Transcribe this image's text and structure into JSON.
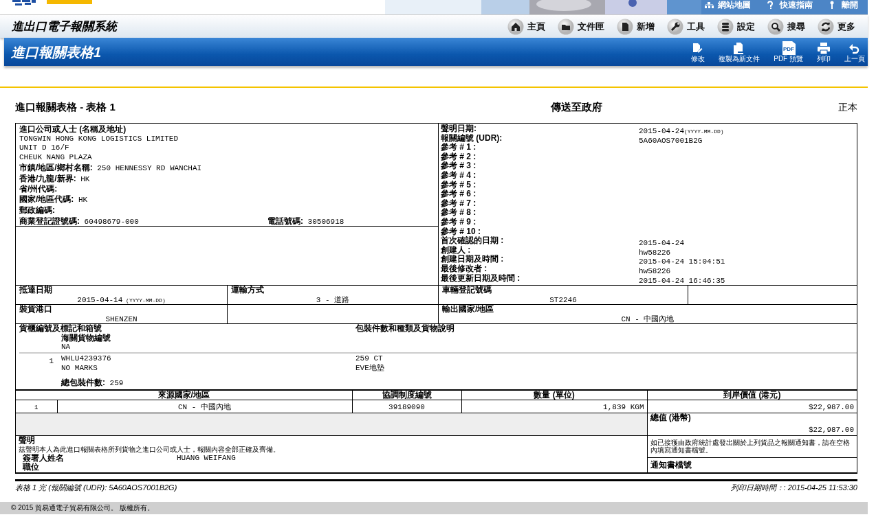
{
  "top_links": [
    {
      "label": "網站地圖",
      "kind": "sitemap"
    },
    {
      "label": "快速指南",
      "kind": "help"
    },
    {
      "label": "離開",
      "kind": "exit"
    }
  ],
  "system_title": "進出口電子報關系統",
  "nav": [
    {
      "label": "主頁",
      "kind": "home"
    },
    {
      "label": "文件匣",
      "kind": "folder"
    },
    {
      "label": "新增",
      "kind": "new"
    },
    {
      "label": "工具",
      "kind": "tools"
    },
    {
      "label": "設定",
      "kind": "settings"
    },
    {
      "label": "搜尋",
      "kind": "search"
    },
    {
      "label": "更多",
      "kind": "more"
    }
  ],
  "page_title": "進口報關表格1",
  "actions": [
    {
      "label": "修改",
      "kind": "edit"
    },
    {
      "label": "複製為新文件",
      "kind": "copy"
    },
    {
      "label": "PDF 預覽",
      "kind": "pdf",
      "icon_text": "PDF"
    },
    {
      "label": "列印",
      "kind": "print"
    },
    {
      "label": "上一頁",
      "kind": "back"
    }
  ],
  "form": {
    "title": "進口報關表格 - 表格 1",
    "destination": "傳送至政府",
    "copy_type": "正本",
    "importer": {
      "heading": "進口公司或人士 (名稱及地址)",
      "lines": [
        "TONGWIN HONG KONG LOGISTICS LIMITED",
        "UNIT D 16/F",
        "CHEUK NANG PLAZA"
      ],
      "fields": [
        {
          "label": "市鎮/地區/鄉村名稱:",
          "value": "250 HENNESSY RD WANCHAI"
        },
        {
          "label": "香港/九龍/新界:",
          "value": "HK"
        },
        {
          "label": "省/州代碼:"
        },
        {
          "label": "國家/地區代碼:",
          "value": "HK"
        },
        {
          "label": "郵政編碼:"
        }
      ],
      "br_label": "商業登記證號碼:",
      "br_value": "60498679-000",
      "phone_label": "電話號碼:",
      "phone_value": "30506918"
    },
    "declaration_info": [
      {
        "label": "聲明日期:",
        "value": "2015-04-24",
        "hint": "(YYYY-MM-DD)"
      },
      {
        "label": "報關編號 (UDR):",
        "value": "5A60AOS7001B2G"
      },
      {
        "label": "參考 # 1 :"
      },
      {
        "label": "參考 # 2 :"
      },
      {
        "label": "參考 # 3 :"
      },
      {
        "label": "參考 # 4 :"
      },
      {
        "label": "參考 # 5 :"
      },
      {
        "label": "參考 # 6 :"
      },
      {
        "label": "參考 # 7 :"
      },
      {
        "label": "參考 # 8 :"
      },
      {
        "label": "參考 # 9 :"
      },
      {
        "label": "參考 # 10 :"
      },
      {
        "label": "首次確認的日期 :",
        "value": "2015-04-24"
      },
      {
        "label": "創建人 :",
        "value": "hw58226"
      },
      {
        "label": "創建日期及時間 :",
        "value": "2015-04-24 15:04:51"
      },
      {
        "label": "最後修改者 :",
        "value": "hw58226"
      },
      {
        "label": "最後更新日期及時間 :",
        "value": "2015-04-24 16:46:35"
      }
    ],
    "arrival": {
      "label": "抵達日期",
      "value": "2015-04-14",
      "hint": "(YYYY-MM-DD)"
    },
    "transport": {
      "label": "運輸方式",
      "value": "3 - 道路"
    },
    "vehicle": {
      "label": "車輛登記號碼",
      "value": "ST2246"
    },
    "loading_port": {
      "label": "裝貨港口",
      "value": "SHENZEN"
    },
    "export_country": {
      "label": "輸出國家/地區",
      "value": "CN - 中國內地"
    },
    "goods": {
      "marks_heading": "貨櫃編號及標記和箱號",
      "desc_heading": "包裝件數和種類及貨物說明",
      "cargo_no_label": "海關貨物編號",
      "cargo_no": "NA",
      "items": [
        {
          "no": "1",
          "marks": [
            "WHLU4239376",
            "NO MARKS"
          ],
          "description": [
            "259 CT",
            "EVE地墊"
          ]
        }
      ],
      "total_label": "總包裝件數:",
      "total": "259"
    },
    "lines_table": {
      "columns": [
        "來源國家/地區",
        "協調制度編號",
        "數量 (單位)",
        "到岸價值 (港元)"
      ],
      "rows": [
        {
          "no": "1",
          "cells": [
            "CN - 中國內地",
            "39189090",
            "1,839 KGM",
            "$22,987.00"
          ]
        }
      ]
    },
    "total_value": {
      "label": "總值 (港幣)",
      "value": "$22,987.00"
    },
    "statement": {
      "heading": "聲明",
      "text": "茲聲明本人為此進口報關表格所列貨物之進口公司或人士，報關內容全部正確及齊備。",
      "signer_label": "簽署人姓名",
      "signer": "HUANG WEIFANG",
      "position_label": "職位"
    },
    "notice": {
      "text": "如已接獲由政府統計處發出關於上列貨品之報關通知書，請在空格內填寫通知書檔號。",
      "file_no_label": "通知書檔號"
    },
    "footer_left": "表格 1 完 (報關編號 (UDR): 5A60AOS7001B2G)",
    "print_time": "列印日期時間：: 2015-04-25 11:53:30"
  },
  "copyright": "© 2015 貿易通電子貿易有限公司。 版權所有。"
}
